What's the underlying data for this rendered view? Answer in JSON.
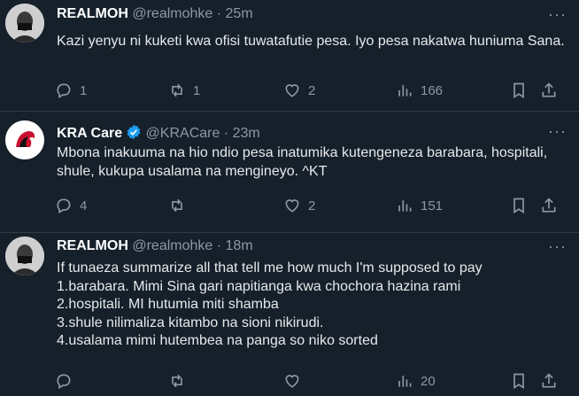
{
  "tweets": [
    {
      "name": "REALMOH",
      "handle": "@realmohke",
      "time": "· 25m",
      "text": "Kazi yenyu ni kuketi kwa ofisi tuwatafutie pesa. Iyo pesa nakatwa huniuma Sana.",
      "replies": "1",
      "retweets": "1",
      "likes": "2",
      "views": "166",
      "more": "···"
    },
    {
      "name": "KRA Care",
      "handle": "@KRACare",
      "time": "· 23m",
      "verified": true,
      "text": "Mbona inakuuma na hio ndio pesa inatumika kutengeneza barabara, hospitali, shule, kukupa usalama na mengineyo. ^KT",
      "replies": "4",
      "retweets": "",
      "likes": "2",
      "views": "151",
      "more": "···"
    },
    {
      "name": "REALMOH",
      "handle": "@realmohke",
      "time": "· 18m",
      "text": "If tunaeza summarize all that tell me how much I'm supposed to pay\n1.barabara. Mimi Sina gari napitianga kwa chochora hazina rami\n2.hospitali. MI hutumia miti shamba\n3.shule  nilimaliza kitambo na sioni nikirudi.\n4.usalama mimi hutembea na panga  so niko sorted",
      "replies": "",
      "retweets": "",
      "likes": "",
      "views": "20",
      "more": "···"
    }
  ],
  "colors": {
    "background": "#15202b",
    "text": "#e7e9ea",
    "muted": "#8b98a5",
    "verified": "#1d9bf0",
    "divider": "#2f3b47"
  },
  "icons": [
    "reply-icon",
    "retweet-icon",
    "like-icon",
    "views-icon",
    "bookmark-icon",
    "share-icon",
    "more-icon",
    "verified-icon"
  ]
}
